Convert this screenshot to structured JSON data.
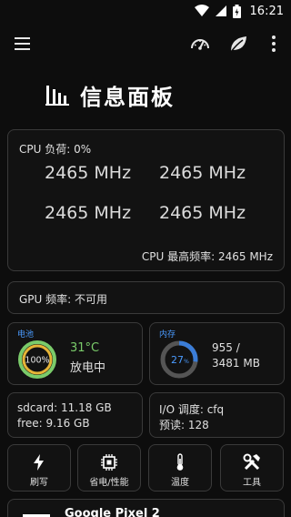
{
  "status_bar": {
    "time": "16:21",
    "icons": [
      "wifi-icon",
      "signal-icon",
      "battery-icon"
    ]
  },
  "toolbar": {
    "icons": [
      "menu-icon",
      "speedometer-icon",
      "leaf-icon",
      "more-vert-icon"
    ]
  },
  "header": {
    "title": "信息面板",
    "icon": "bar-chart-icon"
  },
  "cpu": {
    "label": "CPU 负荷: 0%",
    "cores": [
      "2465 MHz",
      "2465 MHz",
      "2465 MHz",
      "2465 MHz"
    ],
    "max_freq": "CPU 最高频率: 2465 MHz"
  },
  "gpu": {
    "label": "GPU 频率: 不可用"
  },
  "battery": {
    "title": "电池",
    "level_text": "100%",
    "level": 1.0,
    "temperature": "31°C",
    "state": "放电中",
    "colors": {
      "ring": "#7acb6a",
      "ring_inner": "#e6b437",
      "title": "#4a9bff"
    }
  },
  "memory": {
    "title": "内存",
    "percent_text": "27",
    "percent_suffix": "%",
    "usage": 0.27,
    "used": "955 /",
    "total": "3481 MB",
    "colors": {
      "ring": "#3b7dd8",
      "track": "#555555"
    }
  },
  "storage": {
    "sdcard": "sdcard: 11.18 GB",
    "free": "free: 9.16 GB"
  },
  "io": {
    "scheduler": "I/O 调度: cfq",
    "readahead": "预读: 128"
  },
  "tools": [
    {
      "label": "刷写",
      "icon": "flash-icon"
    },
    {
      "label": "省电/性能",
      "icon": "cpu-chip-icon"
    },
    {
      "label": "温度",
      "icon": "thermometer-icon"
    },
    {
      "label": "工具",
      "icon": "tools-icon"
    }
  ],
  "device": {
    "name": "Google Pixel 2"
  }
}
